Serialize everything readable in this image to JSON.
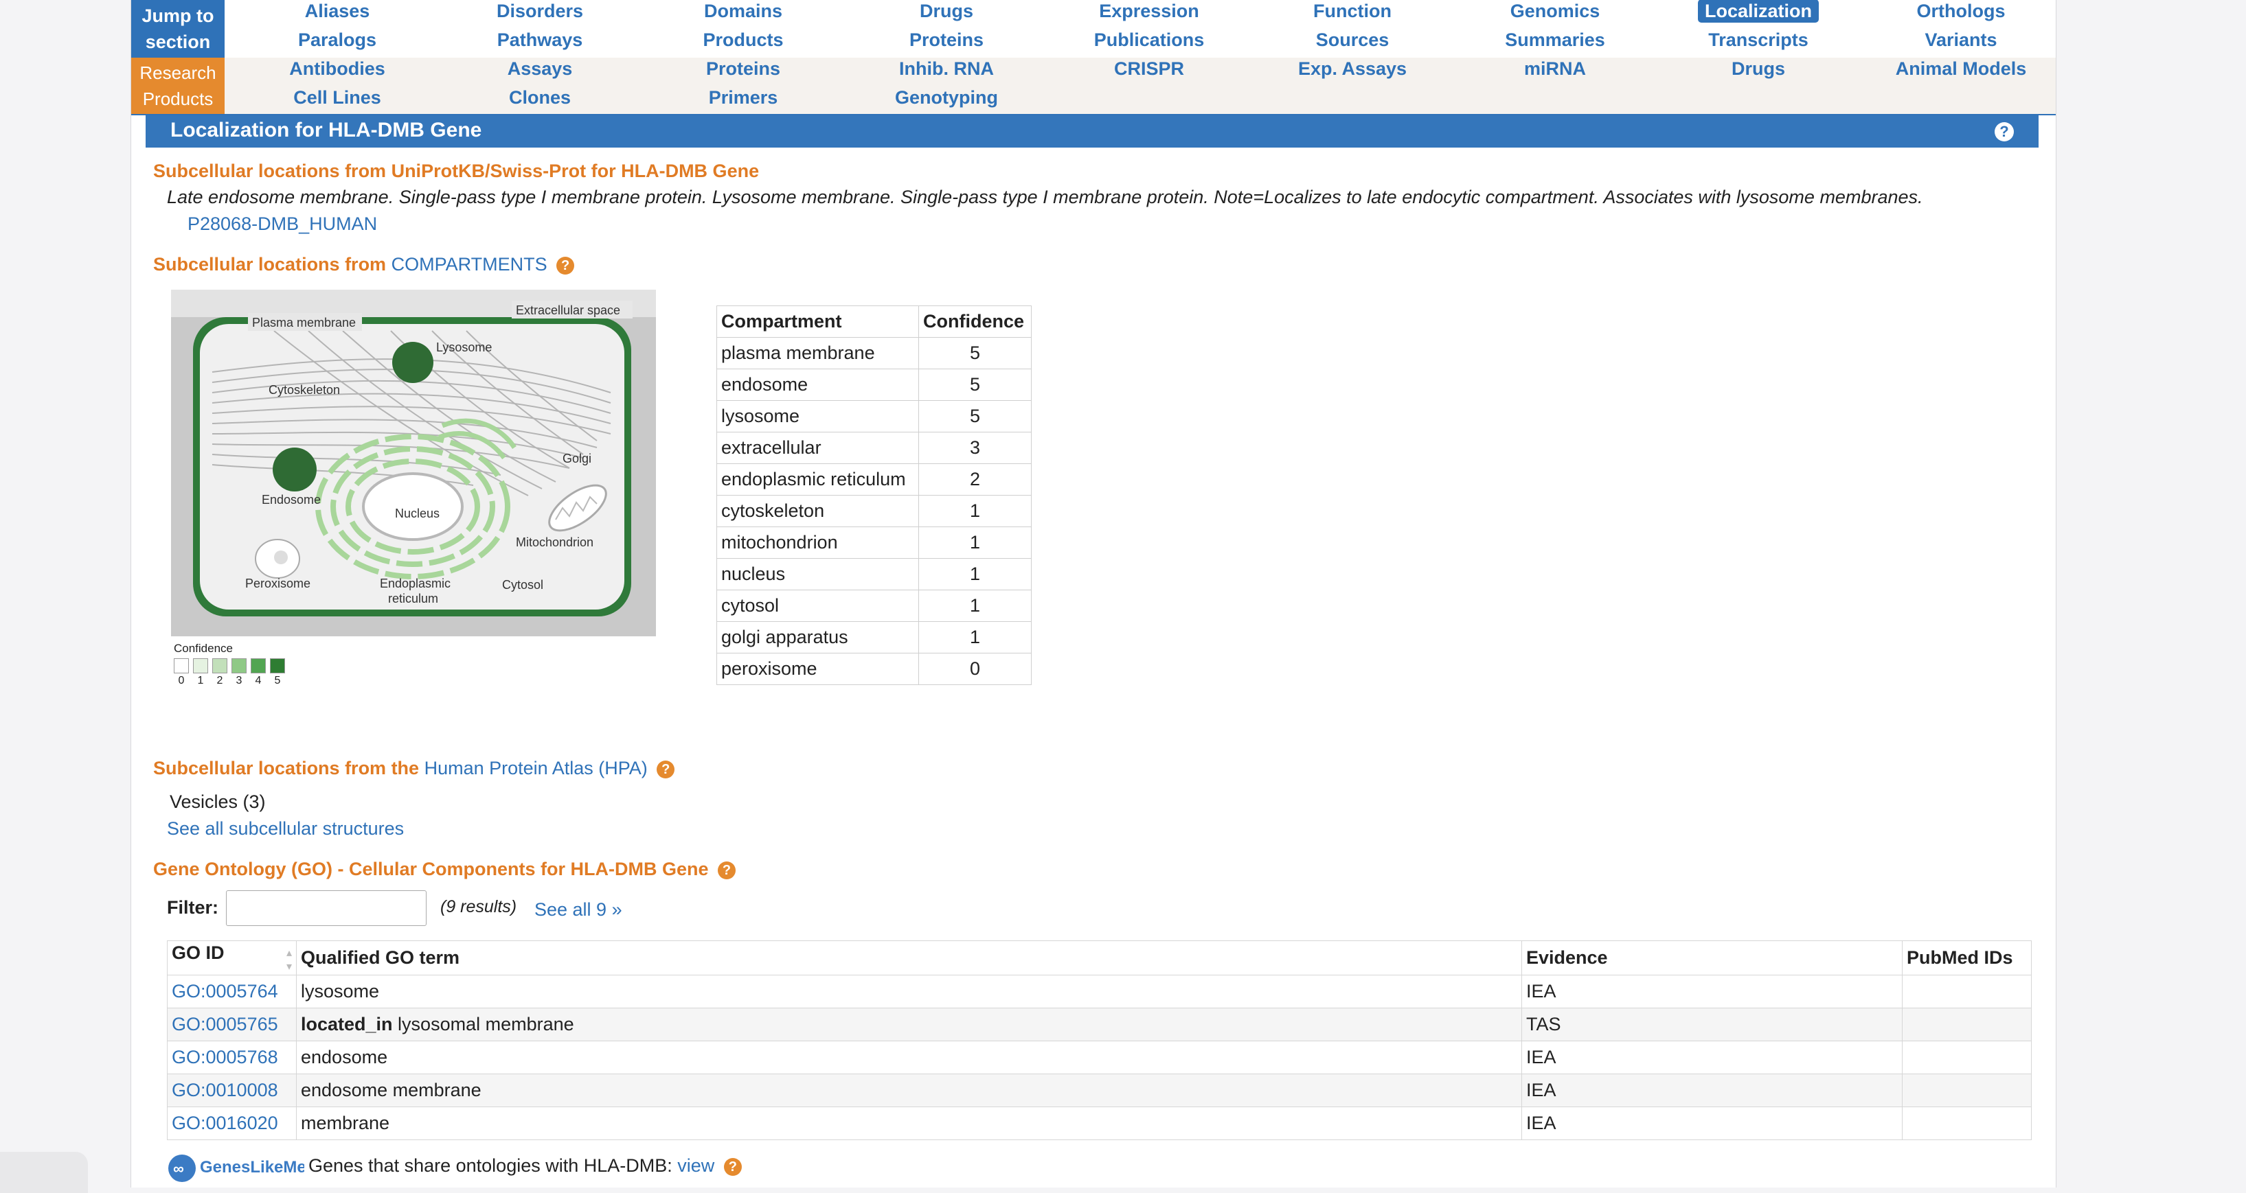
{
  "jump_nav": {
    "row1_head_line1": "Jump to",
    "row1_head_line2": "section",
    "row2_head_line1": "Research",
    "row2_head_line2": "Products",
    "row1": [
      {
        "a": "Aliases",
        "b": "Paralogs"
      },
      {
        "a": "Disorders",
        "b": "Pathways"
      },
      {
        "a": "Domains",
        "b": "Products"
      },
      {
        "a": "Drugs",
        "b": "Proteins"
      },
      {
        "a": "Expression",
        "b": "Publications"
      },
      {
        "a": "Function",
        "b": "Sources"
      },
      {
        "a": "Genomics",
        "b": "Summaries"
      },
      {
        "a": "Localization",
        "b": "Transcripts"
      },
      {
        "a": "Orthologs",
        "b": "Variants"
      }
    ],
    "row2": [
      {
        "a": "Antibodies",
        "b": "Cell Lines"
      },
      {
        "a": "Assays",
        "b": "Clones"
      },
      {
        "a": "Proteins",
        "b": "Primers"
      },
      {
        "a": "Inhib. RNA",
        "b": "Genotyping"
      },
      {
        "a": "CRISPR",
        "b": ""
      },
      {
        "a": "Exp. Assays",
        "b": ""
      },
      {
        "a": "miRNA",
        "b": ""
      },
      {
        "a": "Drugs",
        "b": ""
      },
      {
        "a": "Animal Models",
        "b": ""
      }
    ]
  },
  "section": {
    "title": "Localization for HLA-DMB Gene",
    "uniprot_heading": "Subcellular locations from UniProtKB/Swiss-Prot for HLA-DMB Gene",
    "uniprot_text": "Late endosome membrane. Single-pass type I membrane protein. Lysosome membrane. Single-pass type I membrane protein. Note=Localizes to late endocytic compartment. Associates with lysosome membranes.",
    "uniprot_link": "P28068-DMB_HUMAN",
    "compartments_heading_prefix": "Subcellular locations from",
    "compartments_heading_link": "COMPARTMENTS",
    "hpa_heading_prefix": "Subcellular locations from the",
    "hpa_heading_link": "Human Protein Atlas (HPA)",
    "hpa_value": "Vesicles (3)",
    "hpa_see_all": "See all subcellular structures",
    "go_heading": "Gene Ontology (GO) - Cellular Components for HLA-DMB Gene",
    "filter_label": "Filter:",
    "results_text": "(9 results)",
    "see_all_link": "See all 9 »",
    "geneslike_text": "Genes that share ontologies with HLA-DMB:",
    "geneslike_link": "view",
    "geneslike_logo": "GenesLikeMe"
  },
  "cell_diagram": {
    "labels": {
      "plasma_membrane": "Plasma membrane",
      "extracellular": "Extracellular space",
      "lysosome": "Lysosome",
      "cytoskeleton": "Cytoskeleton",
      "golgi": "Golgi",
      "endosome": "Endosome",
      "nucleus": "Nucleus",
      "mitochondrion": "Mitochondrion",
      "peroxisome": "Peroxisome",
      "er_line1": "Endoplasmic",
      "er_line2": "reticulum",
      "cytosol": "Cytosol"
    },
    "legend_title": "Confidence",
    "legend_values": [
      "0",
      "1",
      "2",
      "3",
      "4",
      "5"
    ],
    "legend_colors": [
      "#ffffff",
      "#e5f2e1",
      "#c2e0ba",
      "#8fc986",
      "#52a552",
      "#2e7d32"
    ]
  },
  "compartments_table": {
    "headers": [
      "Compartment",
      "Confidence"
    ],
    "rows": [
      [
        "plasma membrane",
        "5"
      ],
      [
        "endosome",
        "5"
      ],
      [
        "lysosome",
        "5"
      ],
      [
        "extracellular",
        "3"
      ],
      [
        "endoplasmic reticulum",
        "2"
      ],
      [
        "cytoskeleton",
        "1"
      ],
      [
        "mitochondrion",
        "1"
      ],
      [
        "nucleus",
        "1"
      ],
      [
        "cytosol",
        "1"
      ],
      [
        "golgi apparatus",
        "1"
      ],
      [
        "peroxisome",
        "0"
      ]
    ]
  },
  "go_table": {
    "headers": [
      "GO ID",
      "Qualified GO term",
      "Evidence",
      "PubMed IDs"
    ],
    "rows": [
      {
        "id": "GO:0005764",
        "qualifier": "",
        "term": "lysosome",
        "evidence": "IEA",
        "pubmed": ""
      },
      {
        "id": "GO:0005765",
        "qualifier": "located_in",
        "term": " lysosomal membrane",
        "evidence": "TAS",
        "pubmed": ""
      },
      {
        "id": "GO:0005768",
        "qualifier": "",
        "term": "endosome",
        "evidence": "IEA",
        "pubmed": ""
      },
      {
        "id": "GO:0010008",
        "qualifier": "",
        "term": "endosome membrane",
        "evidence": "IEA",
        "pubmed": ""
      },
      {
        "id": "GO:0016020",
        "qualifier": "",
        "term": "membrane",
        "evidence": "IEA",
        "pubmed": ""
      }
    ]
  },
  "colors": {
    "brand_blue": "#2f72b8",
    "section_bar": "#3476bb",
    "orange": "#e07b24",
    "cell_green": "#2f7a3a"
  }
}
